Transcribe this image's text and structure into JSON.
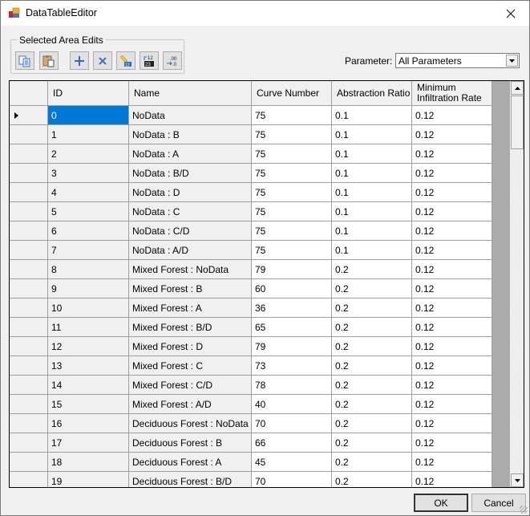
{
  "window": {
    "title": "DataTableEditor",
    "icon": "app-icon",
    "close_icon": "close-icon"
  },
  "toolbar": {
    "group_label": "Selected Area Edits",
    "buttons": [
      {
        "name": "copy-button",
        "icon": "copy-icon",
        "tooltip": "Copy"
      },
      {
        "name": "paste-button",
        "icon": "paste-icon",
        "tooltip": "Paste"
      },
      {
        "name": "add-button",
        "icon": "plus-icon",
        "tooltip": "Add"
      },
      {
        "name": "delete-button",
        "icon": "x-icon",
        "tooltip": "Delete"
      },
      {
        "name": "edit-button",
        "icon": "pencil-icon",
        "tooltip": "Edit"
      },
      {
        "name": "sequence-button",
        "icon": "sequence-icon",
        "tooltip": "Sequence"
      },
      {
        "name": "decimal-button",
        "icon": "decimal-icon",
        "tooltip": "Decimals"
      }
    ]
  },
  "parameter": {
    "label": "Parameter:",
    "selected": "All Parameters"
  },
  "table": {
    "columns": [
      "ID",
      "Name",
      "Curve Number",
      "Abstraction Ratio",
      "Minimum Infiltration Rate"
    ],
    "column_lines": [
      [
        "ID"
      ],
      [
        "Name"
      ],
      [
        "Curve Number"
      ],
      [
        "Abstraction Ratio"
      ],
      [
        "Minimum",
        "Infiltration Rate"
      ]
    ],
    "selected_row": 0,
    "rows": [
      [
        "0",
        "NoData",
        "75",
        "0.1",
        "0.12"
      ],
      [
        "1",
        "NoData : B",
        "75",
        "0.1",
        "0.12"
      ],
      [
        "2",
        "NoData : A",
        "75",
        "0.1",
        "0.12"
      ],
      [
        "3",
        "NoData : B/D",
        "75",
        "0.1",
        "0.12"
      ],
      [
        "4",
        "NoData : D",
        "75",
        "0.1",
        "0.12"
      ],
      [
        "5",
        "NoData : C",
        "75",
        "0.1",
        "0.12"
      ],
      [
        "6",
        "NoData : C/D",
        "75",
        "0.1",
        "0.12"
      ],
      [
        "7",
        "NoData : A/D",
        "75",
        "0.1",
        "0.12"
      ],
      [
        "8",
        "Mixed Forest : NoData",
        "79",
        "0.2",
        "0.12"
      ],
      [
        "9",
        "Mixed Forest : B",
        "60",
        "0.2",
        "0.12"
      ],
      [
        "10",
        "Mixed Forest : A",
        "36",
        "0.2",
        "0.12"
      ],
      [
        "11",
        "Mixed Forest : B/D",
        "65",
        "0.2",
        "0.12"
      ],
      [
        "12",
        "Mixed Forest : D",
        "79",
        "0.2",
        "0.12"
      ],
      [
        "13",
        "Mixed Forest : C",
        "73",
        "0.2",
        "0.12"
      ],
      [
        "14",
        "Mixed Forest : C/D",
        "78",
        "0.2",
        "0.12"
      ],
      [
        "15",
        "Mixed Forest : A/D",
        "40",
        "0.2",
        "0.12"
      ],
      [
        "16",
        "Deciduous Forest : NoData",
        "70",
        "0.2",
        "0.12"
      ],
      [
        "17",
        "Deciduous Forest : B",
        "66",
        "0.2",
        "0.12"
      ],
      [
        "18",
        "Deciduous Forest : A",
        "45",
        "0.2",
        "0.12"
      ],
      [
        "19",
        "Deciduous Forest : B/D",
        "70",
        "0.2",
        "0.12"
      ]
    ]
  },
  "footer": {
    "ok_label": "OK",
    "cancel_label": "Cancel"
  },
  "colors": {
    "selection": "#0078d7",
    "grid_background": "#ababab"
  }
}
